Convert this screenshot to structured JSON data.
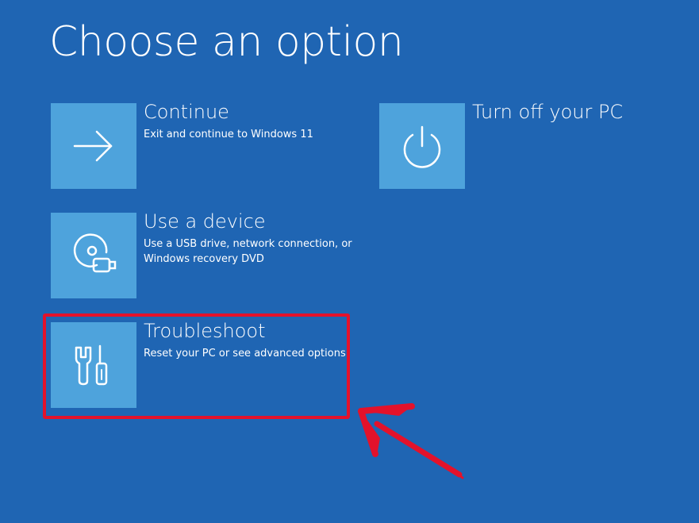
{
  "page": {
    "title": "Choose an option"
  },
  "options": [
    {
      "id": "continue",
      "title": "Continue",
      "description": "Exit and continue to Windows 11",
      "icon": "arrow-right-icon"
    },
    {
      "id": "use-device",
      "title": "Use a device",
      "description": "Use a USB drive, network connection, or Windows recovery DVD",
      "icon": "disc-usb-icon"
    },
    {
      "id": "troubleshoot",
      "title": "Troubleshoot",
      "description": "Reset your PC or see advanced options",
      "icon": "tools-icon"
    },
    {
      "id": "turn-off",
      "title": "Turn off your PC",
      "description": "",
      "icon": "power-icon"
    }
  ],
  "colors": {
    "background": "#1f65b3",
    "tile": "#4ea3dc",
    "text": "#ffffff",
    "annotation": "#e3122b"
  }
}
